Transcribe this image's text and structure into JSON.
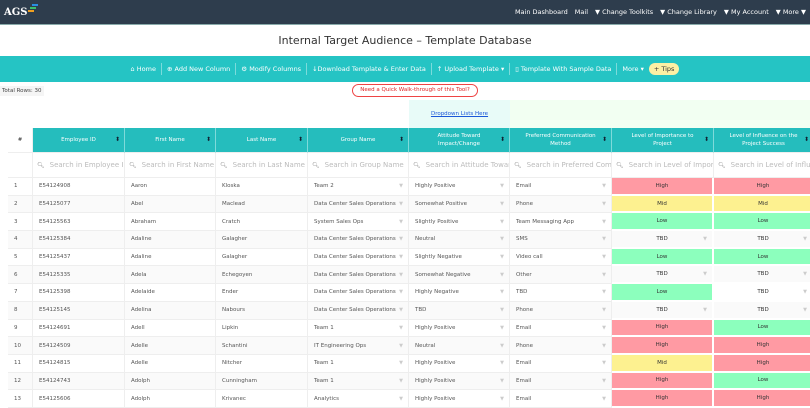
{
  "brand": "AGS",
  "nav": [
    "Main Dashboard",
    "Mail",
    "▼ Change Toolkits",
    "▼ Change Library",
    "▼ My Account",
    "▼ More ▼"
  ],
  "title": "Internal Target Audience – Template Database",
  "toolbar": {
    "home": "Home",
    "add_column": "Add New Column",
    "modify_columns": "Modify Columns",
    "download": "Download Template & Enter Data",
    "upload": "Upload Template",
    "sample": "Template With Sample Data",
    "more": "More",
    "tips": "+ Tips"
  },
  "total_rows": "Total Rows: 30",
  "walkthrough": "Need a Quick Walk-through of this Tool?",
  "dropdown_link": "Dropdown Lists Here",
  "columns": [
    "#",
    "Employee ID",
    "First Name",
    "Last Name",
    "Group Name",
    "Attitude Toward Impact/Change",
    "Preferred Communication Method",
    "Level of Importance to Project",
    "Level of Influence on the Project Success"
  ],
  "search_placeholders": [
    "Search in Employee ID",
    "Search in First Name",
    "Search in Last Name",
    "Search in Group Name",
    "Search in Attitude Toward Impact/Change",
    "Search in Preferred Communication Method",
    "Search in Level of Importance",
    "Search in Level of Influence"
  ],
  "rows": [
    [
      "1",
      "E54124908",
      "Aaron",
      "Kloska",
      "Team 2",
      "Highly Positive",
      "Email",
      "High",
      "High"
    ],
    [
      "2",
      "E54125077",
      "Abel",
      "Maclead",
      "Data Center Sales Operations",
      "Somewhat Positive",
      "Phone",
      "Mid",
      "Mid"
    ],
    [
      "3",
      "E54125563",
      "Abraham",
      "Cratch",
      "System Sales Ops",
      "Slightly Positive",
      "Team Messaging App",
      "Low",
      "Low"
    ],
    [
      "4",
      "E54125384",
      "Adaline",
      "Galagher",
      "Data Center Sales Operations",
      "Neutral",
      "SMS",
      "TBD",
      "TBD"
    ],
    [
      "5",
      "E54125437",
      "Adaline",
      "Galagher",
      "Data Center Sales Operations",
      "Slightly Negative",
      "Video call",
      "Low",
      "Low"
    ],
    [
      "6",
      "E54125335",
      "Adela",
      "Echegoyen",
      "Data Center Sales Operations",
      "Somewhat Negative",
      "Other",
      "TBD",
      "TBD"
    ],
    [
      "7",
      "E54125398",
      "Adelaide",
      "Ender",
      "Data Center Sales Operations",
      "Highly Negative",
      "TBD",
      "Low",
      "TBD"
    ],
    [
      "8",
      "E54125145",
      "Adelina",
      "Nabours",
      "Data Center Sales Operations",
      "TBD",
      "Phone",
      "TBD",
      "TBD"
    ],
    [
      "9",
      "E54124691",
      "Adell",
      "Lipkin",
      "Team 1",
      "Highly Positive",
      "Email",
      "High",
      "Low"
    ],
    [
      "10",
      "E54124509",
      "Adelle",
      "Schantini",
      "IT Engineering Ops",
      "Neutral",
      "Phone",
      "High",
      "High"
    ],
    [
      "11",
      "E54124815",
      "Adelle",
      "Nitcher",
      "Team 1",
      "Highly Positive",
      "Email",
      "Mid",
      "High"
    ],
    [
      "12",
      "E54124743",
      "Adolph",
      "Cunningham",
      "Team 1",
      "Highly Positive",
      "Email",
      "High",
      "Low"
    ],
    [
      "13",
      "E54125606",
      "Adolph",
      "Krivanec",
      "Analytics",
      "Highly Positive",
      "Email",
      "High",
      "High"
    ]
  ],
  "colors": {
    "nav": "#2e3d4d",
    "toolbar": "#25c4c4",
    "high": "#ff9aa3",
    "mid": "#fdf190",
    "low": "#8cffbd"
  }
}
